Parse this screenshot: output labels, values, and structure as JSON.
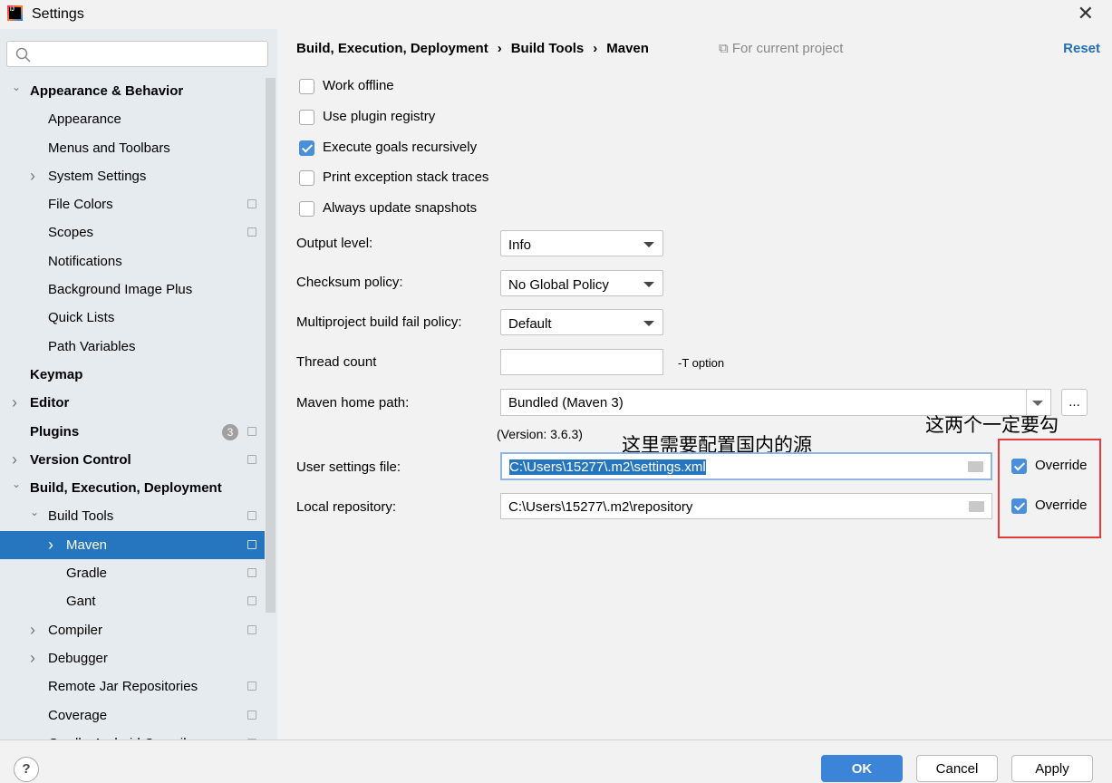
{
  "window": {
    "title": "Settings",
    "close": "✕"
  },
  "sidebar": {
    "items": [
      {
        "label": "Appearance & Behavior",
        "level": 0,
        "bold": true,
        "chevron": "down"
      },
      {
        "label": "Appearance",
        "level": 1
      },
      {
        "label": "Menus and Toolbars",
        "level": 1
      },
      {
        "label": "System Settings",
        "level": 1,
        "chevron": "right"
      },
      {
        "label": "File Colors",
        "level": 1,
        "copy": true
      },
      {
        "label": "Scopes",
        "level": 1,
        "copy": true
      },
      {
        "label": "Notifications",
        "level": 1
      },
      {
        "label": "Background Image Plus",
        "level": 1
      },
      {
        "label": "Quick Lists",
        "level": 1
      },
      {
        "label": "Path Variables",
        "level": 1
      },
      {
        "label": "Keymap",
        "level": 0,
        "bold": true
      },
      {
        "label": "Editor",
        "level": 0,
        "bold": true,
        "chevron": "right"
      },
      {
        "label": "Plugins",
        "level": 0,
        "bold": true,
        "badge": "3",
        "copy": true
      },
      {
        "label": "Version Control",
        "level": 0,
        "bold": true,
        "chevron": "right",
        "copy": true
      },
      {
        "label": "Build, Execution, Deployment",
        "level": 0,
        "bold": true,
        "chevron": "down"
      },
      {
        "label": "Build Tools",
        "level": 1,
        "chevron": "down",
        "copy": true
      },
      {
        "label": "Maven",
        "level": 2,
        "chevron": "right",
        "copy": true,
        "selected": true
      },
      {
        "label": "Gradle",
        "level": 2,
        "copy": true
      },
      {
        "label": "Gant",
        "level": 2,
        "copy": true
      },
      {
        "label": "Compiler",
        "level": 1,
        "chevron": "right",
        "copy": true
      },
      {
        "label": "Debugger",
        "level": 1,
        "chevron": "right"
      },
      {
        "label": "Remote Jar Repositories",
        "level": 1,
        "copy": true
      },
      {
        "label": "Coverage",
        "level": 1,
        "copy": true
      },
      {
        "label": "Gradle-Android Compiler",
        "level": 1,
        "copy": true
      }
    ]
  },
  "breadcrumb": {
    "items": [
      "Build, Execution, Deployment",
      "Build Tools",
      "Maven"
    ],
    "sep": "›",
    "scope": "For current project",
    "reset": "Reset"
  },
  "checkboxes": [
    {
      "label": "Work offline",
      "checked": false
    },
    {
      "label": "Use plugin registry",
      "checked": false
    },
    {
      "label": "Execute goals recursively",
      "checked": true
    },
    {
      "label": "Print exception stack traces",
      "checked": false
    },
    {
      "label": "Always update snapshots",
      "checked": false
    }
  ],
  "form": {
    "output_level": {
      "label": "Output level:",
      "value": "Info"
    },
    "checksum": {
      "label": "Checksum policy:",
      "value": "No Global Policy"
    },
    "fail_policy": {
      "label": "Multiproject build fail policy:",
      "value": "Default"
    },
    "thread_count": {
      "label": "Thread count",
      "value": "",
      "hint": "-T option"
    },
    "maven_home": {
      "label": "Maven home path:",
      "value": "Bundled (Maven 3)",
      "browse": "...",
      "version": "(Version: 3.6.3)"
    },
    "user_settings": {
      "label": "User settings file:",
      "value": "C:\\Users\\15277\\.m2\\settings.xml",
      "override": "Override",
      "override_checked": true
    },
    "local_repo": {
      "label": "Local repository:",
      "value": "C:\\Users\\15277\\.m2\\repository",
      "override": "Override",
      "override_checked": true
    }
  },
  "annotations": {
    "settings_note": "这里需要配置国内的源",
    "override_note": "这两个一定要勾",
    "highlight_color": "#e83a3a"
  },
  "footer": {
    "help": "?",
    "ok": "OK",
    "cancel": "Cancel",
    "apply": "Apply"
  }
}
